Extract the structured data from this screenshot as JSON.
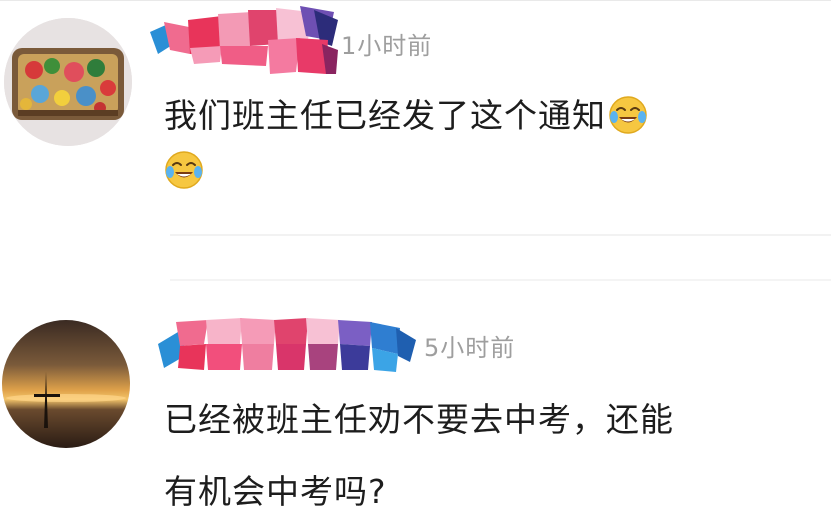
{
  "comments": [
    {
      "time": "1小时前",
      "text": "我们班主任已经发了这个通知",
      "emoji_icon": "crying-laughing-face-icon"
    },
    {
      "time": "5小时前",
      "text_line1": "已经被班主任劝不要去中考，还能",
      "text_line2": "有机会中考吗?"
    }
  ]
}
